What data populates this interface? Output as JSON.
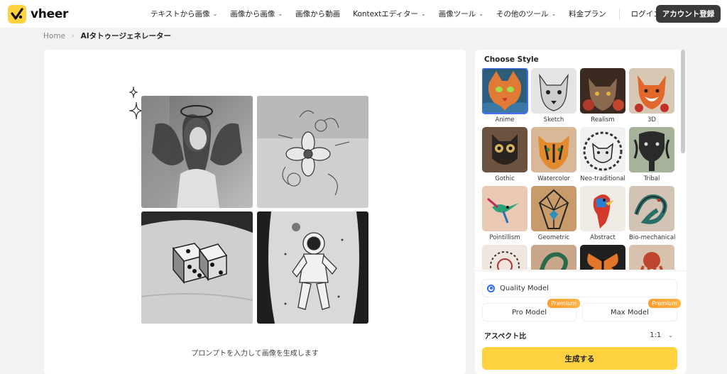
{
  "brand": {
    "name": "vheer",
    "accent": "#ffd23f"
  },
  "nav": {
    "items": [
      {
        "label": "テキストから画像",
        "dropdown": true
      },
      {
        "label": "画像から画像",
        "dropdown": true
      },
      {
        "label": "画像から動画",
        "dropdown": false
      },
      {
        "label": "Kontextエディター",
        "dropdown": true
      },
      {
        "label": "画像ツール",
        "dropdown": true
      },
      {
        "label": "その他のツール",
        "dropdown": true
      },
      {
        "label": "料金プラン",
        "dropdown": false
      }
    ],
    "login": "ログイン",
    "signup": "アカウント登録"
  },
  "breadcrumb": {
    "home": "Home",
    "current": "AIタトゥージェネレーター"
  },
  "canvas": {
    "caption": "プロンプトを入力して画像を生成します"
  },
  "styles": {
    "title": "Choose Style",
    "items": [
      {
        "label": "Anime",
        "selected": true
      },
      {
        "label": "Sketch"
      },
      {
        "label": "Realism"
      },
      {
        "label": "3D"
      },
      {
        "label": "Gothic"
      },
      {
        "label": "Watercolor"
      },
      {
        "label": "Neo-traditional"
      },
      {
        "label": "Tribal"
      },
      {
        "label": "Pointillism"
      },
      {
        "label": "Geometric"
      },
      {
        "label": "Abstract"
      },
      {
        "label": "Bio-mechanical"
      },
      {
        "label": ""
      },
      {
        "label": ""
      },
      {
        "label": ""
      },
      {
        "label": ""
      }
    ]
  },
  "models": {
    "quality": "Quality Model",
    "pro": "Pro Model",
    "max": "Max Model",
    "premium_badge": "Premium"
  },
  "aspect": {
    "label": "アスペクト比",
    "value": "1:1"
  },
  "generate_label": "生成する"
}
